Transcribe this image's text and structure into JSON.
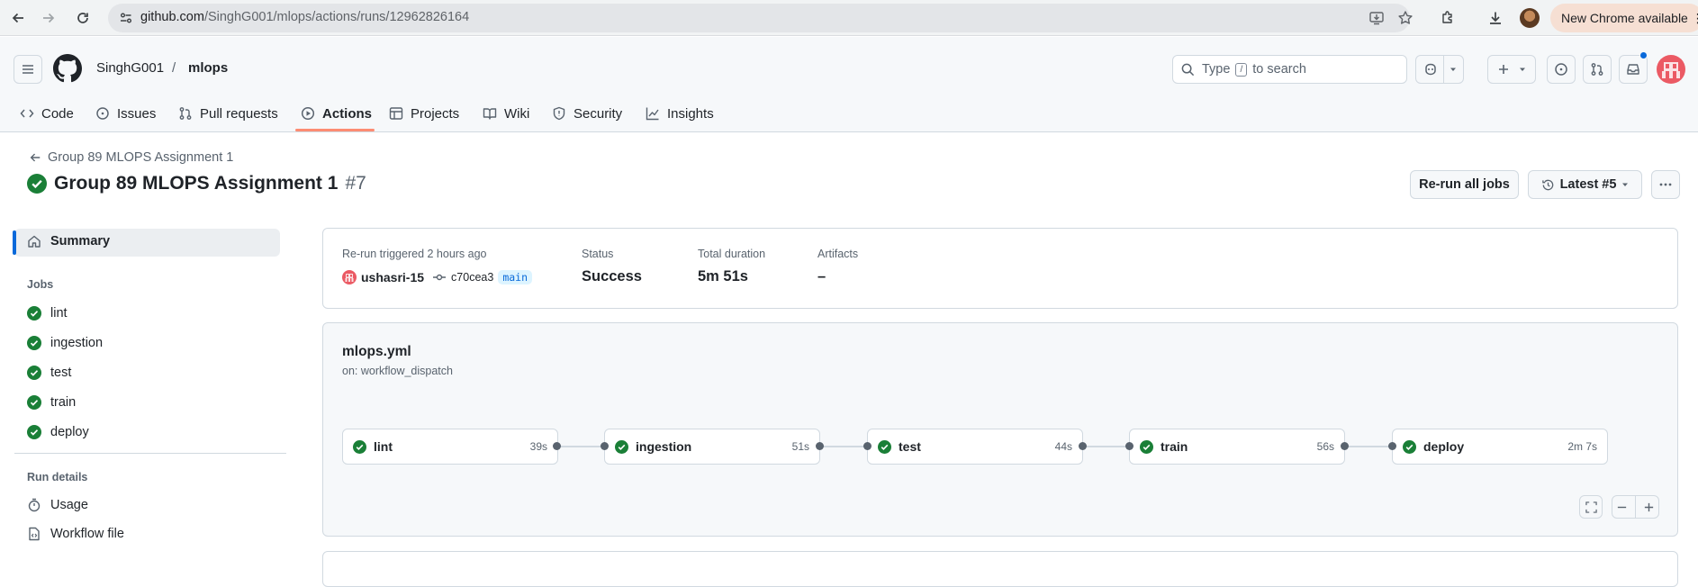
{
  "browser": {
    "url_host": "github.com",
    "url_path": "/SinghG001/mlops/actions/runs/12962826164",
    "new_chrome": "New Chrome available"
  },
  "repo": {
    "owner": "SinghG001",
    "separator": "/",
    "name": "mlops"
  },
  "search": {
    "pre": "Type",
    "key": "/",
    "post": "to search"
  },
  "tabs": [
    {
      "label": "Code",
      "icon": "code-icon"
    },
    {
      "label": "Issues",
      "icon": "issue-icon"
    },
    {
      "label": "Pull requests",
      "icon": "pull-request-icon"
    },
    {
      "label": "Actions",
      "icon": "play-icon"
    },
    {
      "label": "Projects",
      "icon": "table-icon"
    },
    {
      "label": "Wiki",
      "icon": "book-icon"
    },
    {
      "label": "Security",
      "icon": "shield-icon"
    },
    {
      "label": "Insights",
      "icon": "graph-icon"
    }
  ],
  "run": {
    "back_label": "Group 89 MLOPS Assignment 1",
    "title": "Group 89 MLOPS Assignment 1",
    "number": "#7",
    "rerun_button": "Re-run all jobs",
    "attempt_button": "Latest #5"
  },
  "sidebar": {
    "summary": "Summary",
    "jobs_heading": "Jobs",
    "jobs": [
      "lint",
      "ingestion",
      "test",
      "train",
      "deploy"
    ],
    "run_details_heading": "Run details",
    "usage": "Usage",
    "workflow_file": "Workflow file"
  },
  "summary": {
    "trigger_label": "Re-run triggered 2 hours ago",
    "actor": "ushasri-15",
    "commit": "c70cea3",
    "branch": "main",
    "status_label": "Status",
    "status_value": "Success",
    "duration_label": "Total duration",
    "duration_value": "5m 51s",
    "artifacts_label": "Artifacts",
    "artifacts_value": "–"
  },
  "workflow": {
    "file": "mlops.yml",
    "trigger": "on: workflow_dispatch",
    "jobs": [
      {
        "name": "lint",
        "duration": "39s"
      },
      {
        "name": "ingestion",
        "duration": "51s"
      },
      {
        "name": "test",
        "duration": "44s"
      },
      {
        "name": "train",
        "duration": "56s"
      },
      {
        "name": "deploy",
        "duration": "2m 7s"
      }
    ]
  },
  "colors": {
    "success": "#1a7f37",
    "accent": "#0969da",
    "tab_underline": "#fd8c73"
  }
}
